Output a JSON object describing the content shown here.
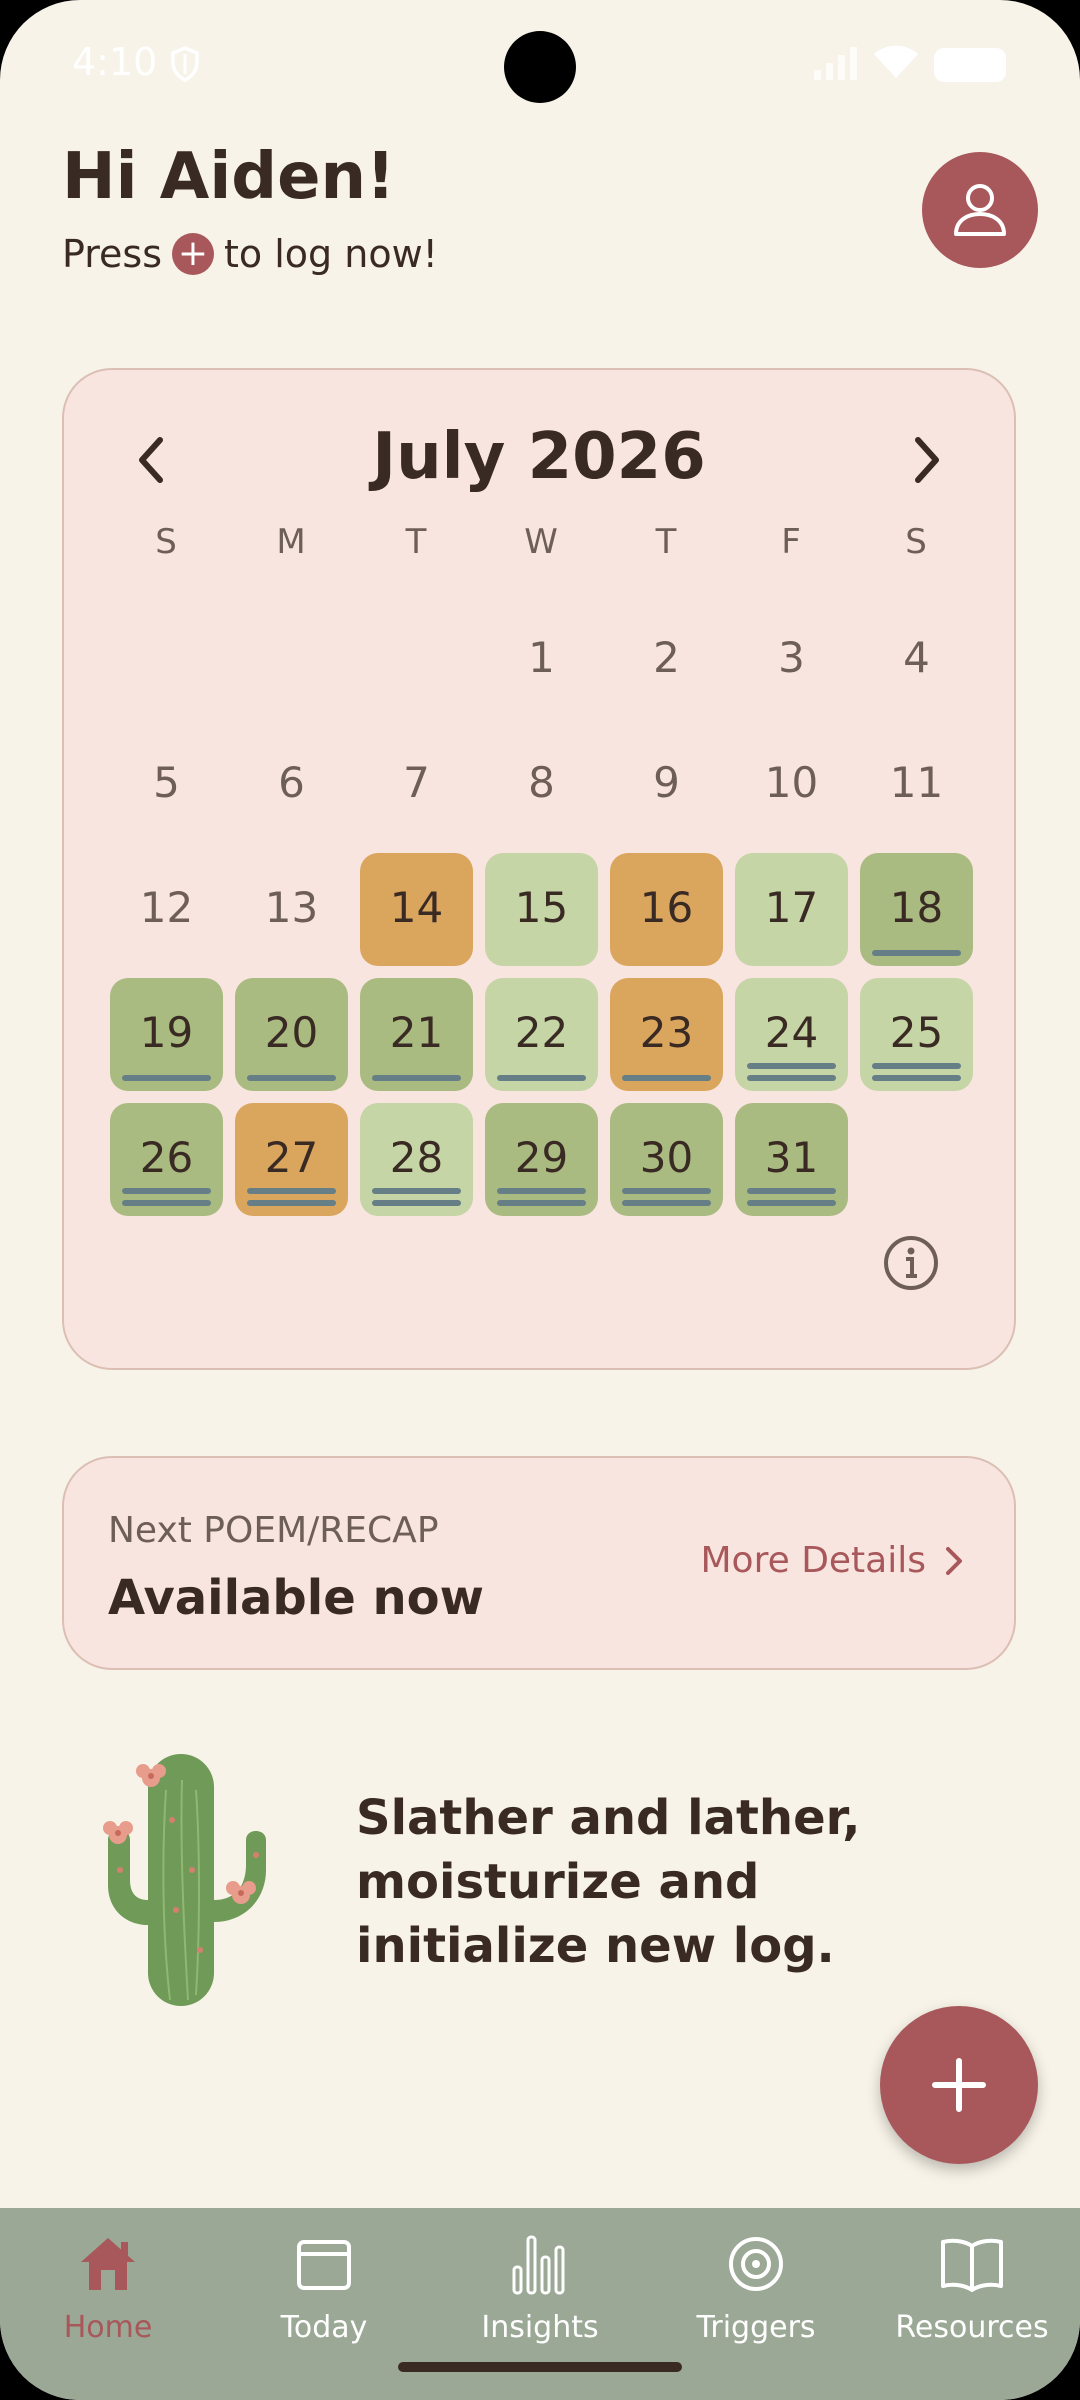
{
  "status_bar": {
    "time": "4:10"
  },
  "header": {
    "greeting": "Hi Aiden!",
    "prompt_before": "Press",
    "prompt_plus": "+",
    "prompt_after": "to log now!"
  },
  "calendar": {
    "month_title": "July 2026",
    "weekdays": [
      "S",
      "M",
      "T",
      "W",
      "T",
      "F",
      "S"
    ],
    "days": [
      {
        "d": "1",
        "s": "none",
        "b": 0
      },
      {
        "d": "2",
        "s": "none",
        "b": 0
      },
      {
        "d": "3",
        "s": "none",
        "b": 0
      },
      {
        "d": "4",
        "s": "none",
        "b": 0
      },
      {
        "d": "5",
        "s": "none",
        "b": 0
      },
      {
        "d": "6",
        "s": "none",
        "b": 0
      },
      {
        "d": "7",
        "s": "none",
        "b": 0
      },
      {
        "d": "8",
        "s": "none",
        "b": 0
      },
      {
        "d": "9",
        "s": "none",
        "b": 0
      },
      {
        "d": "10",
        "s": "none",
        "b": 0
      },
      {
        "d": "11",
        "s": "none",
        "b": 0
      },
      {
        "d": "12",
        "s": "none",
        "b": 0
      },
      {
        "d": "13",
        "s": "none",
        "b": 0
      },
      {
        "d": "14",
        "s": "orange",
        "b": 0
      },
      {
        "d": "15",
        "s": "light-green",
        "b": 0
      },
      {
        "d": "16",
        "s": "orange",
        "b": 0
      },
      {
        "d": "17",
        "s": "light-green",
        "b": 0
      },
      {
        "d": "18",
        "s": "green",
        "b": 1
      },
      {
        "d": "19",
        "s": "green",
        "b": 1
      },
      {
        "d": "20",
        "s": "green",
        "b": 1
      },
      {
        "d": "21",
        "s": "green",
        "b": 1
      },
      {
        "d": "22",
        "s": "light-green",
        "b": 1
      },
      {
        "d": "23",
        "s": "orange",
        "b": 1
      },
      {
        "d": "24",
        "s": "light-green",
        "b": 2
      },
      {
        "d": "25",
        "s": "light-green",
        "b": 2
      },
      {
        "d": "26",
        "s": "green",
        "b": 2
      },
      {
        "d": "27",
        "s": "orange",
        "b": 2
      },
      {
        "d": "28",
        "s": "light-green",
        "b": 2
      },
      {
        "d": "29",
        "s": "green",
        "b": 2
      },
      {
        "d": "30",
        "s": "green",
        "b": 2
      },
      {
        "d": "31",
        "s": "green",
        "b": 2
      }
    ],
    "first_weekday_index": 3
  },
  "next_poem": {
    "label": "Next POEM/RECAP",
    "status": "Available now",
    "link": "More Details"
  },
  "tip": {
    "text": "Slather and lather, moisturize and initialize new log."
  },
  "bottom_nav": [
    {
      "label": "Home",
      "icon": "home-icon",
      "active": true
    },
    {
      "label": "Today",
      "icon": "calendar-icon",
      "active": false
    },
    {
      "label": "Insights",
      "icon": "bar-chart-icon",
      "active": false
    },
    {
      "label": "Triggers",
      "icon": "target-icon",
      "active": false
    },
    {
      "label": "Resources",
      "icon": "book-icon",
      "active": false
    }
  ],
  "colors": {
    "background": "#f7f3e8",
    "accent": "#a8585a",
    "card": "#f9e5e0",
    "nav": "#9aa895",
    "day_green": "#a9bb80",
    "day_light_green": "#c5d5a6",
    "day_orange": "#daa65e",
    "bar": "#667f86"
  }
}
